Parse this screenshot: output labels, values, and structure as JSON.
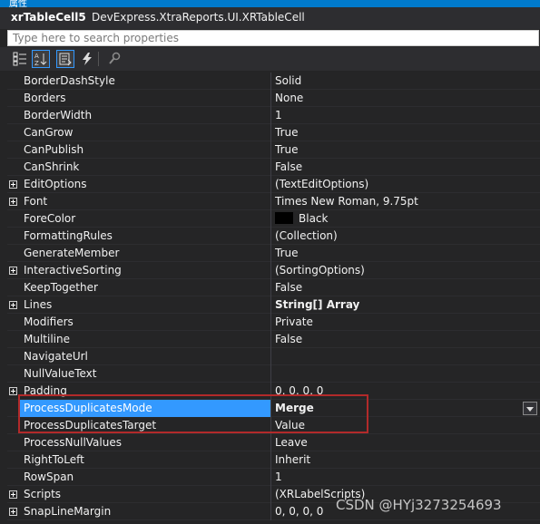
{
  "window": {
    "title": "属性"
  },
  "header": {
    "object_name": "xrTableCell5",
    "object_type": "DevExpress.XtraReports.UI.XRTableCell"
  },
  "search": {
    "placeholder": "Type here to search properties",
    "value": ""
  },
  "toolbar": {
    "buttons": [
      {
        "icon": "categorized-icon",
        "active": false
      },
      {
        "icon": "alphabetical-icon",
        "active": true
      },
      {
        "icon": "properties-icon",
        "active": true
      },
      {
        "icon": "events-icon",
        "active": false
      },
      {
        "icon": "property-pages-icon",
        "active": false
      }
    ]
  },
  "properties": [
    {
      "name": "BorderDashStyle",
      "value": "Solid"
    },
    {
      "name": "Borders",
      "value": "None"
    },
    {
      "name": "BorderWidth",
      "value": "1"
    },
    {
      "name": "CanGrow",
      "value": "True"
    },
    {
      "name": "CanPublish",
      "value": "True"
    },
    {
      "name": "CanShrink",
      "value": "False"
    },
    {
      "name": "EditOptions",
      "value": "(TextEditOptions)",
      "expandable": true
    },
    {
      "name": "Font",
      "value": "Times New Roman, 9.75pt",
      "expandable": true
    },
    {
      "name": "ForeColor",
      "value": "Black",
      "swatch": "#000000"
    },
    {
      "name": "FormattingRules",
      "value": "(Collection)"
    },
    {
      "name": "GenerateMember",
      "value": "True"
    },
    {
      "name": "InteractiveSorting",
      "value": "(SortingOptions)",
      "expandable": true
    },
    {
      "name": "KeepTogether",
      "value": "False"
    },
    {
      "name": "Lines",
      "value": "String[] Array",
      "expandable": true,
      "bold": true
    },
    {
      "name": "Modifiers",
      "value": "Private"
    },
    {
      "name": "Multiline",
      "value": "False"
    },
    {
      "name": "NavigateUrl",
      "value": ""
    },
    {
      "name": "NullValueText",
      "value": ""
    },
    {
      "name": "Padding",
      "value": "0, 0, 0, 0",
      "expandable": true
    },
    {
      "name": "ProcessDuplicatesMode",
      "value": "Merge",
      "selected": true,
      "bold": true,
      "dropdown": true
    },
    {
      "name": "ProcessDuplicatesTarget",
      "value": "Value"
    },
    {
      "name": "ProcessNullValues",
      "value": "Leave"
    },
    {
      "name": "RightToLeft",
      "value": "Inherit"
    },
    {
      "name": "RowSpan",
      "value": "1"
    },
    {
      "name": "Scripts",
      "value": "(XRLabelScripts)",
      "expandable": true
    },
    {
      "name": "SnapLineMargin",
      "value": "0, 0, 0, 0",
      "expandable": true
    }
  ],
  "watermark": "CSDN @HYj3273254693",
  "colors": {
    "selection": "#3399ff",
    "highlight_border": "#b22a2a",
    "background": "#252526"
  }
}
